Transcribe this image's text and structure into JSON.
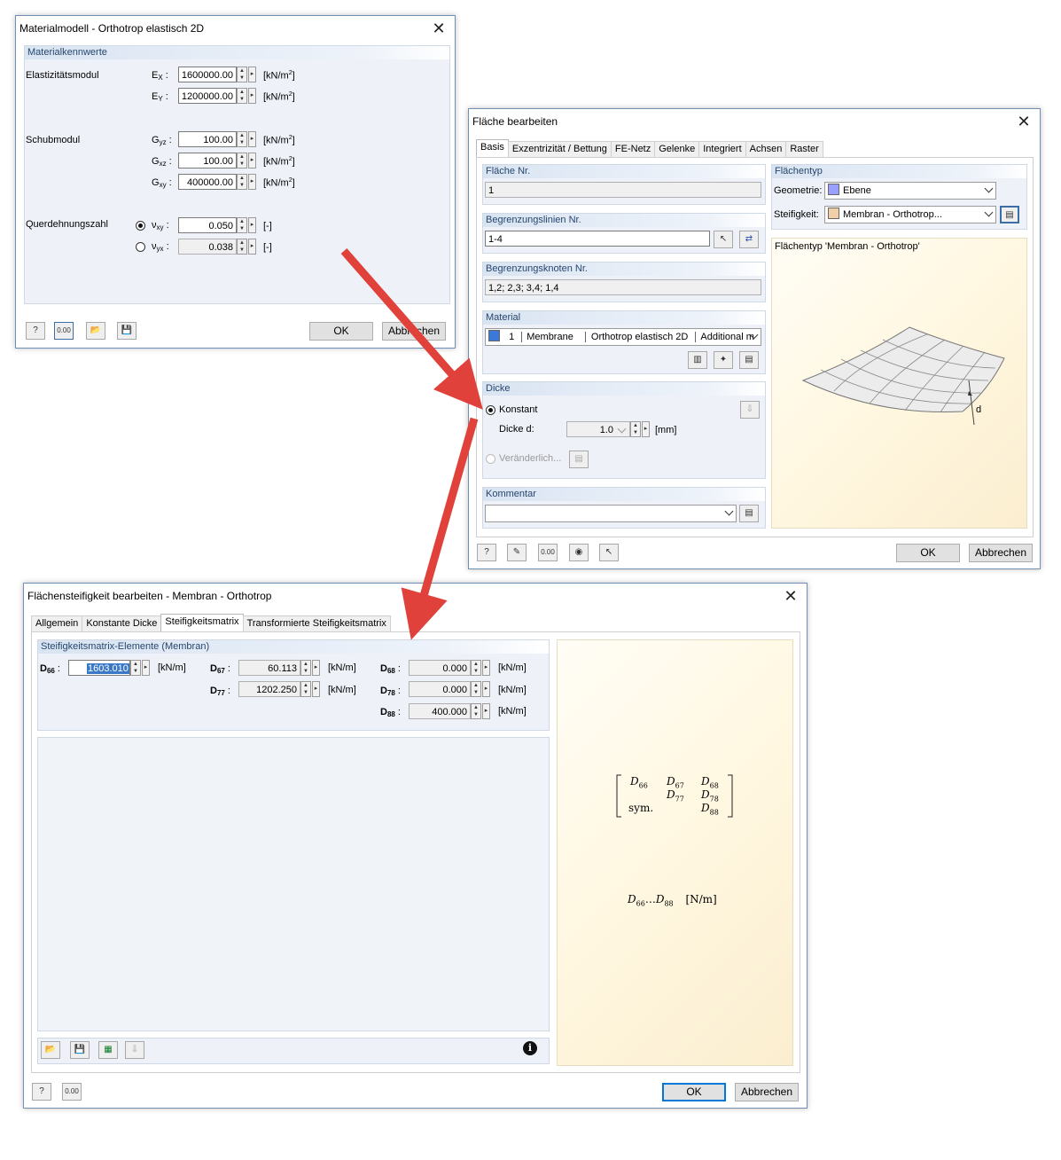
{
  "material_dialog": {
    "title": "Materialmodell - Orthotrop elastisch 2D",
    "group_label": "Materialkennwerte",
    "elastic_label": "Elastizitätsmodul",
    "shear_label": "Schubmodul",
    "poisson_label": "Querdehnungszahl",
    "ex_sym": "E",
    "ex_sub": "X",
    "ex_value": "1600000.00",
    "ey_sym": "E",
    "ey_sub": "Y",
    "ey_value": "1200000.00",
    "gyz_sym": "G",
    "gyz_sub": "yz",
    "gyz_value": "100.00",
    "gxz_sym": "G",
    "gxz_sub": "xz",
    "gxz_value": "100.00",
    "gxy_sym": "G",
    "gxy_sub": "xy",
    "gxy_value": "400000.00",
    "vxy_sym": "ν",
    "vxy_sub": "xy",
    "vxy_value": "0.050",
    "vyx_sym": "ν",
    "vyx_sub": "yx",
    "vyx_value": "0.038",
    "unit_kn": "[kN/m",
    "unit_sq": "2",
    "unit_end": "]",
    "unit_dimless": "[-]",
    "ok_label": "OK",
    "cancel_label": "Abbrechen",
    "colon": ":"
  },
  "surface_dialog": {
    "title": "Fläche bearbeiten",
    "tabs": [
      "Basis",
      "Exzentrizität / Bettung",
      "FE-Netz",
      "Gelenke",
      "Integriert",
      "Achsen",
      "Raster"
    ],
    "surface_no_label": "Fläche Nr.",
    "surface_no_value": "1",
    "boundary_lines_label": "Begrenzungslinien Nr.",
    "boundary_lines_value": "1-4",
    "boundary_nodes_label": "Begrenzungsknoten Nr.",
    "boundary_nodes_value": "1,2; 2,3; 3,4; 1,4",
    "material_label": "Material",
    "material_no": "1",
    "material_name": "Membrane",
    "material_model": "Orthotrop elastisch 2D",
    "material_extra": "Additional m",
    "material_color": "#3c78d8",
    "thickness_label": "Dicke",
    "constant_label": "Konstant",
    "thickness_d_label": "Dicke d:",
    "thickness_value": "1.0",
    "thickness_unit": "[mm]",
    "variable_label": "Veränderlich...",
    "comment_label": "Kommentar",
    "surface_type_label": "Flächentyp",
    "geometry_label": "Geometrie:",
    "geometry_value": "Ebene",
    "geometry_color": "#9aa0ff",
    "stiffness_label": "Steifigkeit:",
    "stiffness_value": "Membran - Orthotrop...",
    "stiffness_color": "#f2cfa6",
    "preview_caption": "Flächentyp 'Membran - Orthotrop'",
    "preview_d": "d",
    "ok_label": "OK",
    "cancel_label": "Abbrechen"
  },
  "stiffness_dialog": {
    "title": "Flächensteifigkeit bearbeiten - Membran - Orthotrop",
    "tabs": [
      "Allgemein",
      "Konstante Dicke",
      "Steifigkeitsmatrix",
      "Transformierte Steifigkeitsmatrix"
    ],
    "group_label": "Steifigkeitsmatrix-Elemente (Membran)",
    "d66_label": "D",
    "d66_sub": "66",
    "d66_value": "1603.010",
    "d67_label": "D",
    "d67_sub": "67",
    "d67_value": "60.113",
    "d68_label": "D",
    "d68_sub": "68",
    "d68_value": "0.000",
    "d77_label": "D",
    "d77_sub": "77",
    "d77_value": "1202.250",
    "d78_label": "D",
    "d78_sub": "78",
    "d78_value": "0.000",
    "d88_label": "D",
    "d88_sub": "88",
    "d88_value": "400.000",
    "unit": "[kN/m]",
    "colon": ":",
    "matrix_sym": "sym.",
    "range_text": "…",
    "range_unit": "[N/m]",
    "ok_label": "OK",
    "cancel_label": "Abbrechen"
  },
  "icons": [
    "help-icon",
    "units-icon",
    "open-icon",
    "save-icon",
    "edit-icon",
    "view-icon",
    "pick-icon",
    "info-icon",
    "library-icon",
    "new-icon"
  ],
  "colors": {
    "arrow": "#e0413a",
    "accent": "#0078d7",
    "group_header": "#26466d"
  }
}
